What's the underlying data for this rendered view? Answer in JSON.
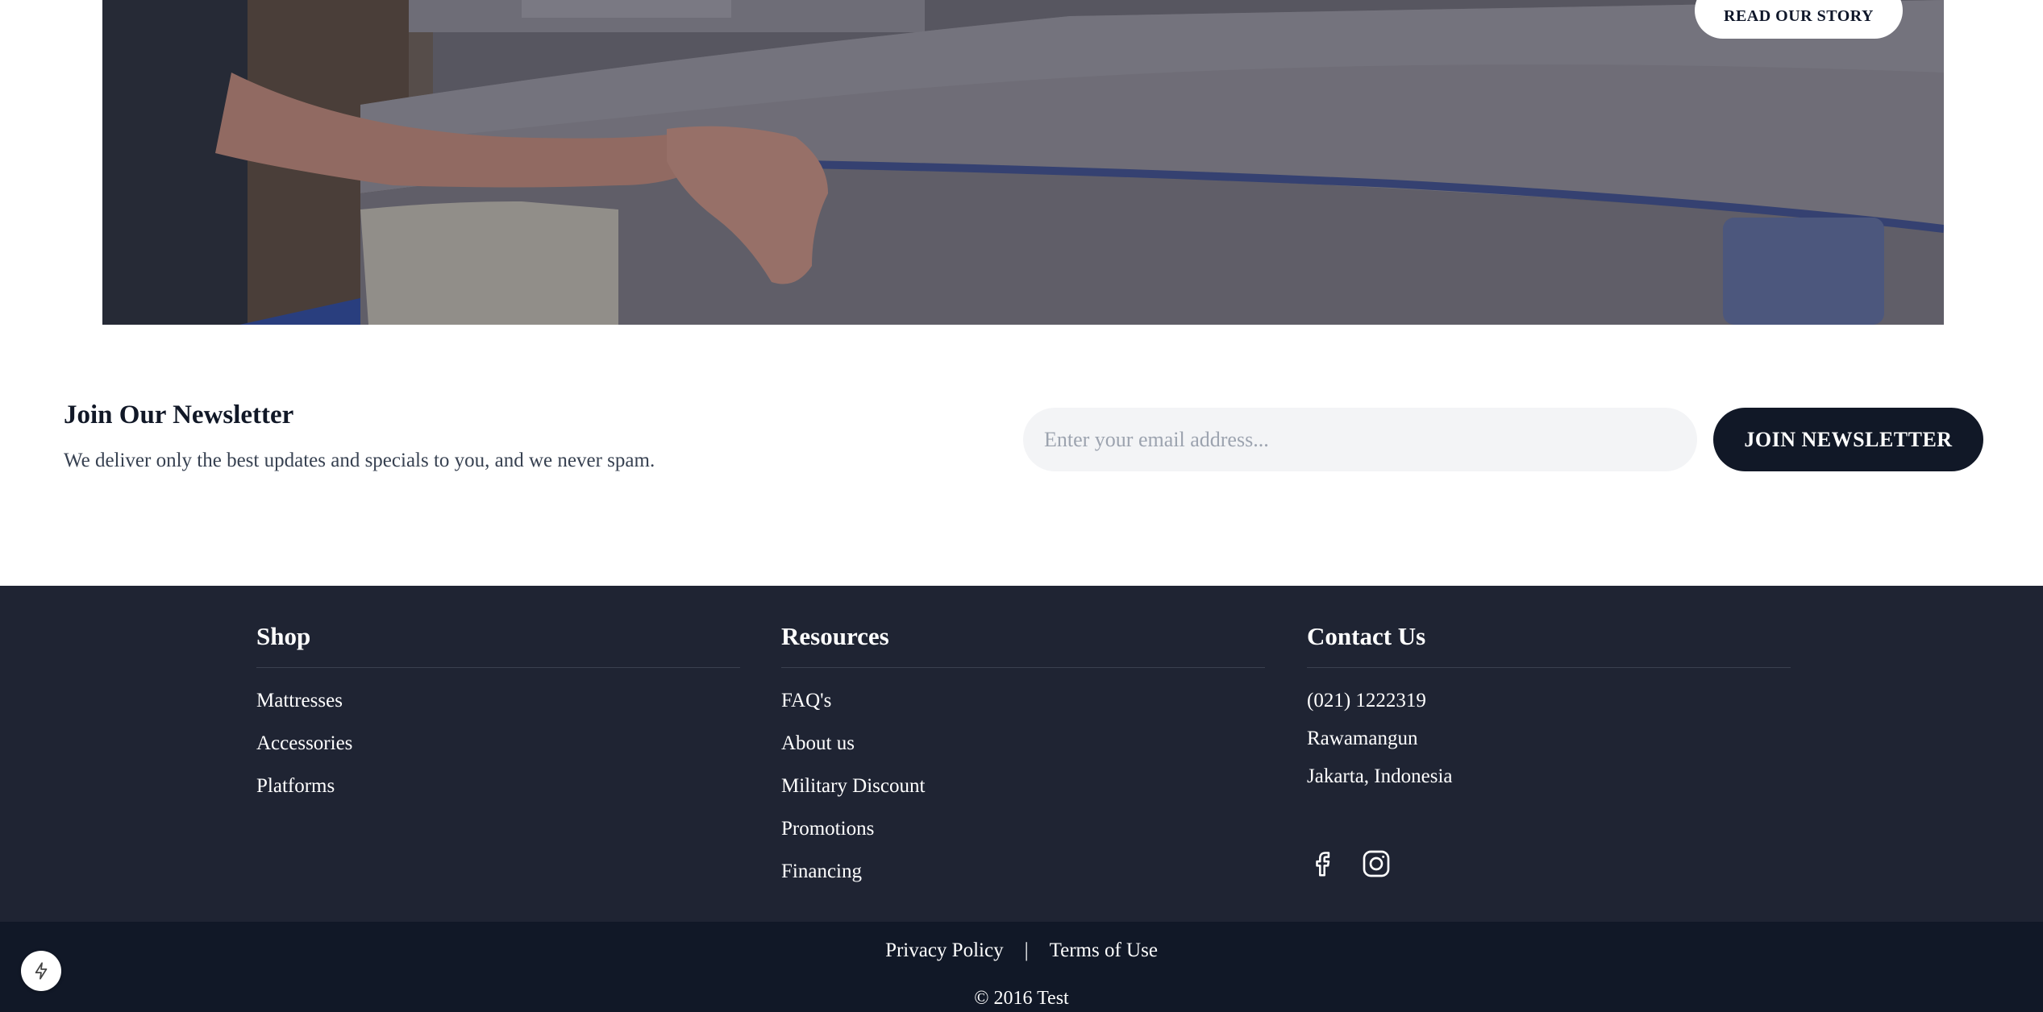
{
  "hero": {
    "button_label": "READ OUR STORY"
  },
  "newsletter": {
    "title": "Join Our Newsletter",
    "subtitle": "We deliver only the best updates and specials to you, and we never spam.",
    "email_placeholder": "Enter your email address...",
    "button_label": "JOIN NEWSLETTER"
  },
  "footer": {
    "shop": {
      "heading": "Shop",
      "items": [
        "Mattresses",
        "Accessories",
        "Platforms"
      ]
    },
    "resources": {
      "heading": "Resources",
      "items": [
        "FAQ's",
        "About us",
        "Military Discount",
        "Promotions",
        "Financing"
      ]
    },
    "contact": {
      "heading": "Contact Us",
      "phone": "(021) 1222319",
      "address_line1": "Rawamangun",
      "address_line2": "Jakarta, Indonesia",
      "social_icons": [
        "facebook-icon",
        "instagram-icon"
      ]
    },
    "legal": {
      "privacy": "Privacy Policy",
      "separator": "|",
      "terms": "Terms of Use"
    },
    "copyright": "© 2016 Test"
  },
  "colors": {
    "dark_navy": "#111827",
    "footer_bg": "#1f2433",
    "input_bg": "#f3f4f6"
  }
}
